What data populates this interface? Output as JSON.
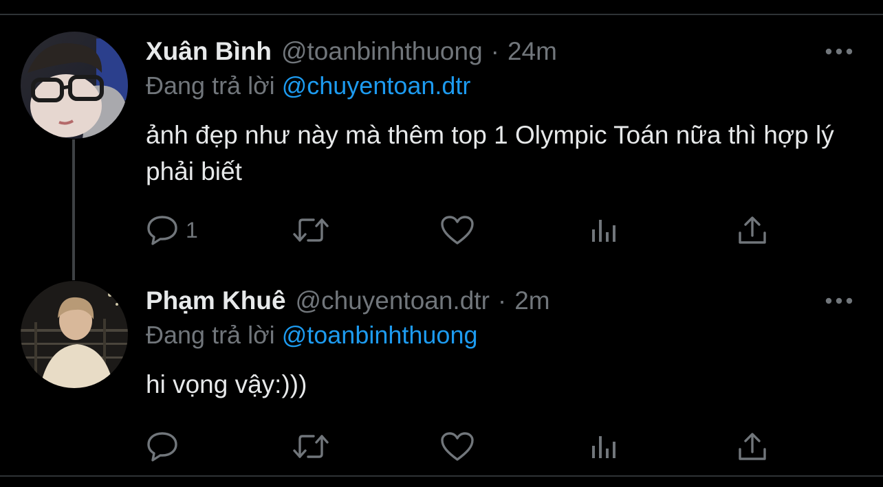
{
  "colors": {
    "background": "#000000",
    "text_primary": "#e7e9ea",
    "text_secondary": "#71767b",
    "accent": "#1d9bf0",
    "divider": "#2f3336",
    "thread_line": "#3e4144"
  },
  "tweets": [
    {
      "display_name": "Xuân Bình",
      "handle": "@toanbinhthuong",
      "separator": "·",
      "time": "24m",
      "reply_prefix": "Đang trả lời",
      "reply_to": "@chuyentoan.dtr",
      "text": "ảnh đẹp như này mà thêm top 1 Olympic Toán nữa thì hợp lý phải biết",
      "reply_count": "1",
      "icons": [
        "more-icon",
        "reply-icon",
        "retweet-icon",
        "like-icon",
        "views-icon",
        "share-icon"
      ]
    },
    {
      "display_name": "Phạm Khuê",
      "handle": "@chuyentoan.dtr",
      "separator": "·",
      "time": "2m",
      "reply_prefix": "Đang trả lời",
      "reply_to": "@toanbinhthuong",
      "text": "hi vọng vậy:)))",
      "reply_count": "",
      "icons": [
        "more-icon",
        "reply-icon",
        "retweet-icon",
        "like-icon",
        "views-icon",
        "share-icon"
      ]
    }
  ]
}
